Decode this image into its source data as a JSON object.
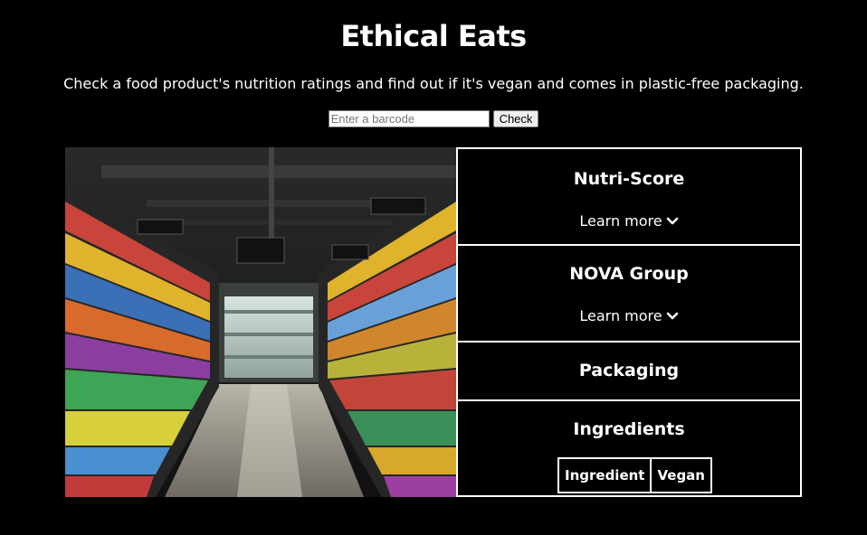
{
  "header": {
    "title": "Ethical Eats",
    "subtitle": "Check a food product's nutrition ratings and find out if it's vegan and comes in plastic-free packaging."
  },
  "search": {
    "placeholder": "Enter a barcode",
    "value": "",
    "button_label": "Check"
  },
  "hero_image": {
    "description": "supermarket-aisle-photo"
  },
  "cards": {
    "nutri_score": {
      "title": "Nutri-Score",
      "learn_more": "Learn more"
    },
    "nova_group": {
      "title": "NOVA Group",
      "learn_more": "Learn more"
    },
    "packaging": {
      "title": "Packaging"
    },
    "ingredients": {
      "title": "Ingredients",
      "columns": [
        "Ingredient",
        "Vegan"
      ]
    }
  },
  "icons": {
    "learn_more_icon": "chevron-down-icon"
  },
  "colors": {
    "background": "#000000",
    "text": "#ffffff",
    "border": "#ffffff"
  }
}
